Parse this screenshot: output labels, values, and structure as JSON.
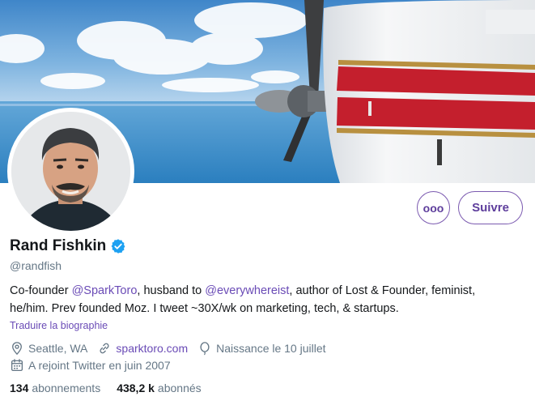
{
  "profile": {
    "name": "Rand Fishkin",
    "handle": "@randfish",
    "verified": true
  },
  "actions": {
    "more_label": "ooo",
    "follow_label": "Suivre"
  },
  "bio": {
    "line1_a": "Co-founder ",
    "mention1": "@SparkToro",
    "line1_b": ", husband to ",
    "mention2": "@everywhereist",
    "line1_c": ", author of Lost & Founder, feminist,",
    "line2": "he/him. Prev founded Moz. I tweet ~30X/wk on marketing, tech, & startups."
  },
  "translate_label": "Traduire la biographie",
  "meta": {
    "location": "Seattle, WA",
    "website": "sparktoro.com",
    "birthday": "Naissance le 10 juillet",
    "joined": "A rejoint Twitter en juin 2007"
  },
  "stats": {
    "following_count": "134",
    "following_label": "abonnements",
    "followers_count": "438,2 k",
    "followers_label": "abonnés"
  },
  "colors": {
    "accent": "#6a4bb6",
    "secondary_text": "#657786",
    "verified": "#1da1f2"
  },
  "icons": {
    "location": "location-pin-icon",
    "website": "link-icon",
    "birthday": "balloon-icon",
    "joined": "calendar-icon",
    "verified": "verified-badge-icon"
  }
}
